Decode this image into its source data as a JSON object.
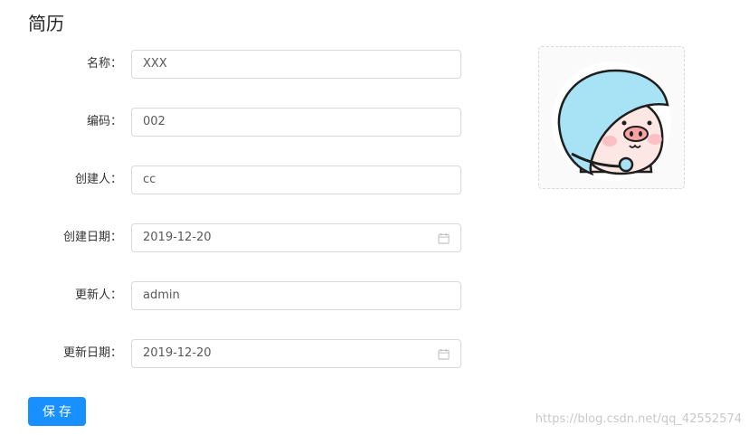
{
  "page": {
    "title": "简历"
  },
  "form": {
    "fields": [
      {
        "label": "名称：",
        "value": "XXX",
        "type": "text"
      },
      {
        "label": "编码：",
        "value": "002",
        "type": "text"
      },
      {
        "label": "创建人：",
        "value": "cc",
        "type": "text"
      },
      {
        "label": "创建日期：",
        "value": "2019-12-20",
        "type": "date",
        "icon": "calendar-icon"
      },
      {
        "label": "更新人：",
        "value": "admin",
        "type": "text"
      },
      {
        "label": "更新日期：",
        "value": "2019-12-20",
        "type": "date",
        "icon": "calendar-icon"
      }
    ]
  },
  "avatar": {
    "icon": "pig-helmet-avatar"
  },
  "actions": {
    "save_label": "保存"
  },
  "watermark": {
    "text": "https://blog.csdn.net/qq_42552574"
  },
  "colors": {
    "primary": "#1890ff",
    "border": "#d9d9d9",
    "text": "#333333"
  }
}
